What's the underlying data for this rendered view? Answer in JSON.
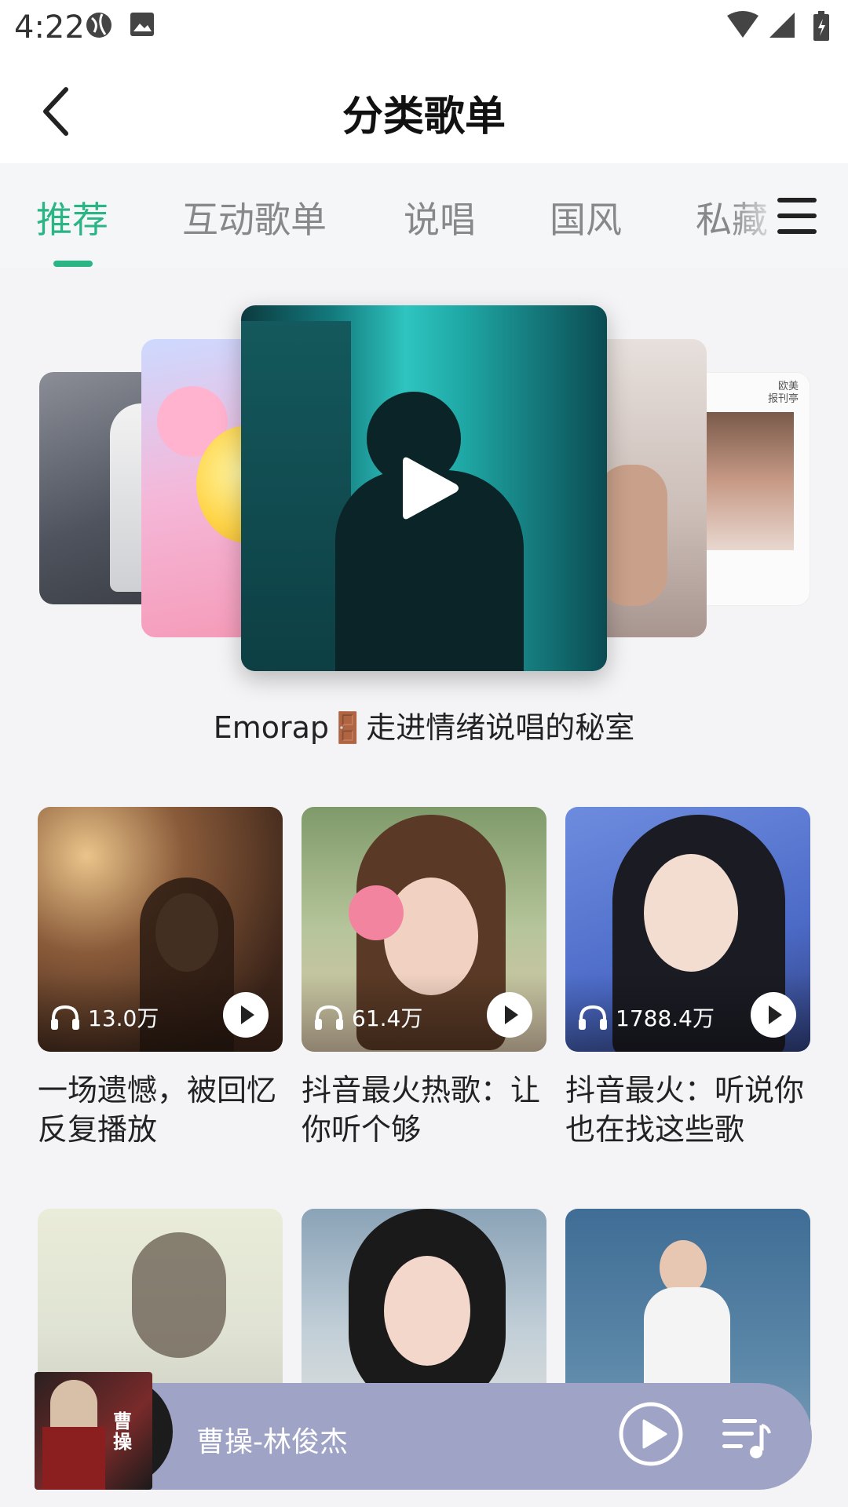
{
  "status_bar": {
    "time": "4:22"
  },
  "header": {
    "title": "分类歌单"
  },
  "tabs": [
    {
      "label": "推荐"
    },
    {
      "label": "互动歌单"
    },
    {
      "label": "说唱"
    },
    {
      "label": "国风"
    },
    {
      "label": "私藏"
    }
  ],
  "carousel": {
    "title": "Emorap🚪走进情绪说唱的秘室",
    "side_label": "欧美\n报刊亭"
  },
  "playlists": [
    {
      "count": "13.0万",
      "title": "一场遗憾，被回忆反复播放"
    },
    {
      "count": "61.4万",
      "title": "抖音最火热歌：让你听个够"
    },
    {
      "count": "1788.4万",
      "title": "抖音最火：听说你也在找这些歌"
    },
    {
      "count": "",
      "title": ""
    },
    {
      "count": "",
      "title": ""
    },
    {
      "count": "",
      "title": ""
    }
  ],
  "player": {
    "song": "曹操-林俊杰",
    "cover_text": "曹操"
  },
  "colors": {
    "accent": "#2bb585",
    "player_bg": "#9fa3c6"
  }
}
